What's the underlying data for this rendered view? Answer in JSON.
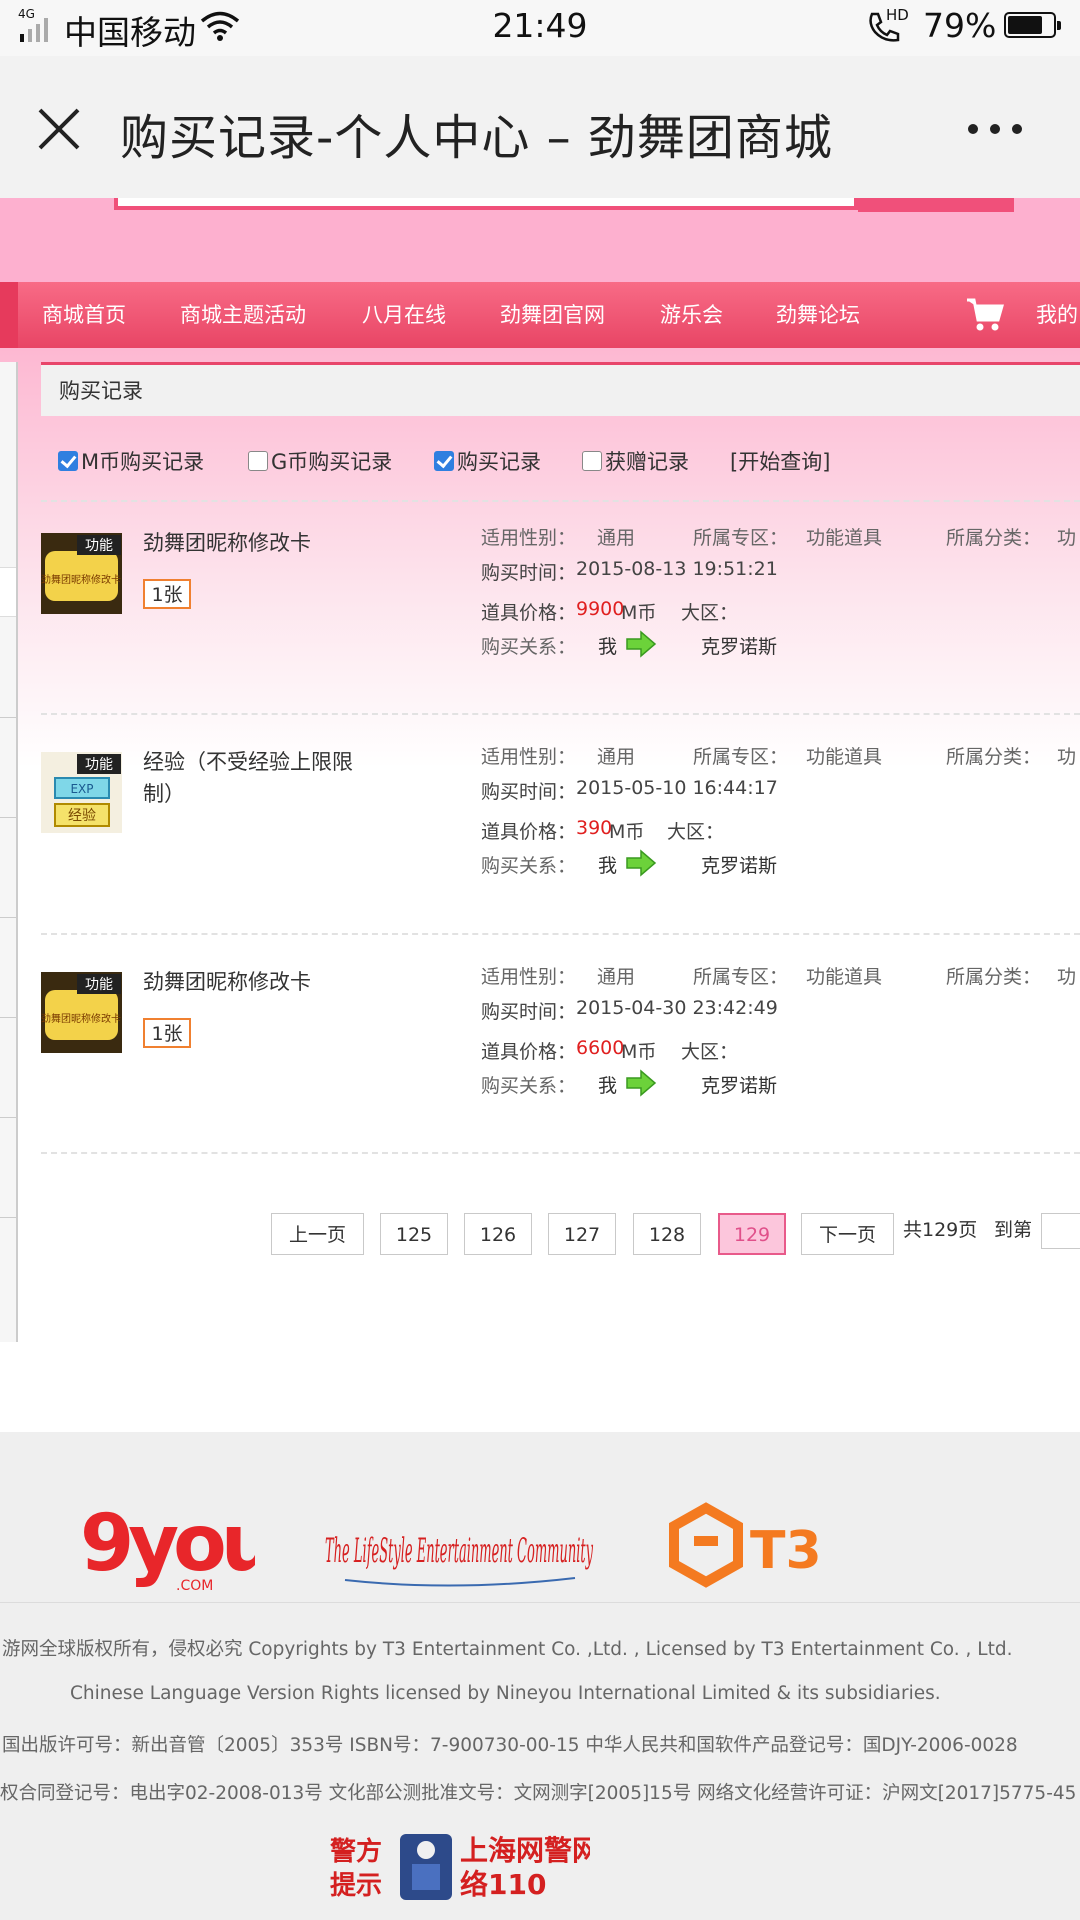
{
  "status_bar": {
    "network": "4G",
    "carrier": "中国移动",
    "time": "21:49",
    "hd": "HD",
    "battery": "79%"
  },
  "title_bar": {
    "title": "购买记录-个人中心 – 劲舞团商城"
  },
  "nav": {
    "items": [
      "商城首页",
      "商城主题活动",
      "八月在线",
      "劲舞团官网",
      "游乐会",
      "劲舞论坛"
    ],
    "my_label": "我的"
  },
  "breadcrumb": "购买记录",
  "filters": [
    {
      "label": "M币购买记录",
      "checked": true
    },
    {
      "label": "G币购买记录",
      "checked": false
    },
    {
      "label": "购买记录",
      "checked": true
    },
    {
      "label": "获赠记录",
      "checked": false
    }
  ],
  "query_label": "[开始查询]",
  "labels": {
    "gender": "适用性别：",
    "zone": "所属专区：",
    "category": "所属分类：",
    "time": "购买时间：",
    "price": "道具价格：",
    "region": "大区：",
    "relation": "购买关系：",
    "me": "我",
    "currency": "M币"
  },
  "records": [
    {
      "name": "劲舞团昵称修改卡",
      "qty": "1张",
      "thumb_badge": "功能",
      "thumb_text": "劲舞团昵称修改卡",
      "gender": "通用",
      "zone": "功能道具",
      "category": "功",
      "time": "2015-08-13 19:51:21",
      "price": "9900",
      "target": "克罗诺斯"
    },
    {
      "name": "经验（不受经验上限限制）",
      "qty": "",
      "thumb_badge": "功能",
      "thumb_text": "经验",
      "thumb_sub": "EXP",
      "gender": "通用",
      "zone": "功能道具",
      "category": "功",
      "time": "2015-05-10 16:44:17",
      "price": "390",
      "target": "克罗诺斯"
    },
    {
      "name": "劲舞团昵称修改卡",
      "qty": "1张",
      "thumb_badge": "功能",
      "thumb_text": "劲舞团昵称修改卡",
      "gender": "通用",
      "zone": "功能道具",
      "category": "功",
      "time": "2015-04-30 23:42:49",
      "price": "6600",
      "target": "克罗诺斯"
    }
  ],
  "pagination": {
    "prev": "上一页",
    "pages": [
      "125",
      "126",
      "127",
      "128",
      "129"
    ],
    "current": "129",
    "next": "下一页",
    "total": "共129页",
    "goto": "到第"
  },
  "footer": {
    "logo_9you": "9you",
    "logo_9you_sub": ".COM",
    "logo_lse": "The LifeStyle Entertainment Community",
    "logo_t3": "T3",
    "lines": [
      "游网全球版权所有，侵权必究 Copyrights by T3 Entertainment Co. ,Ltd. , Licensed by T3 Entertainment Co. , Ltd.",
      "Chinese Language Version Rights licensed by Nineyou International Limited & its subsidiaries.",
      "国出版许可号：新出音管〔2005〕353号 ISBN号：7-900730-00-15 中华人民共和国软件产品登记号：国DJY-2006-0028",
      "权合同登记号：电出字02-2008-013号 文化部公测批准文号：文网测字[2005]15号 网络文化经营许可证：沪网文[2017]5775-45"
    ],
    "police_left": "警方提示",
    "police_right": "上海网警网络110"
  },
  "colors": {
    "nav_bg": "#f0506e",
    "header_pink": "#fdb0cf",
    "accent": "#e8456a",
    "price_red": "#e02020",
    "checkbox_blue": "#2f7fe0",
    "qty_border": "#f08030"
  }
}
